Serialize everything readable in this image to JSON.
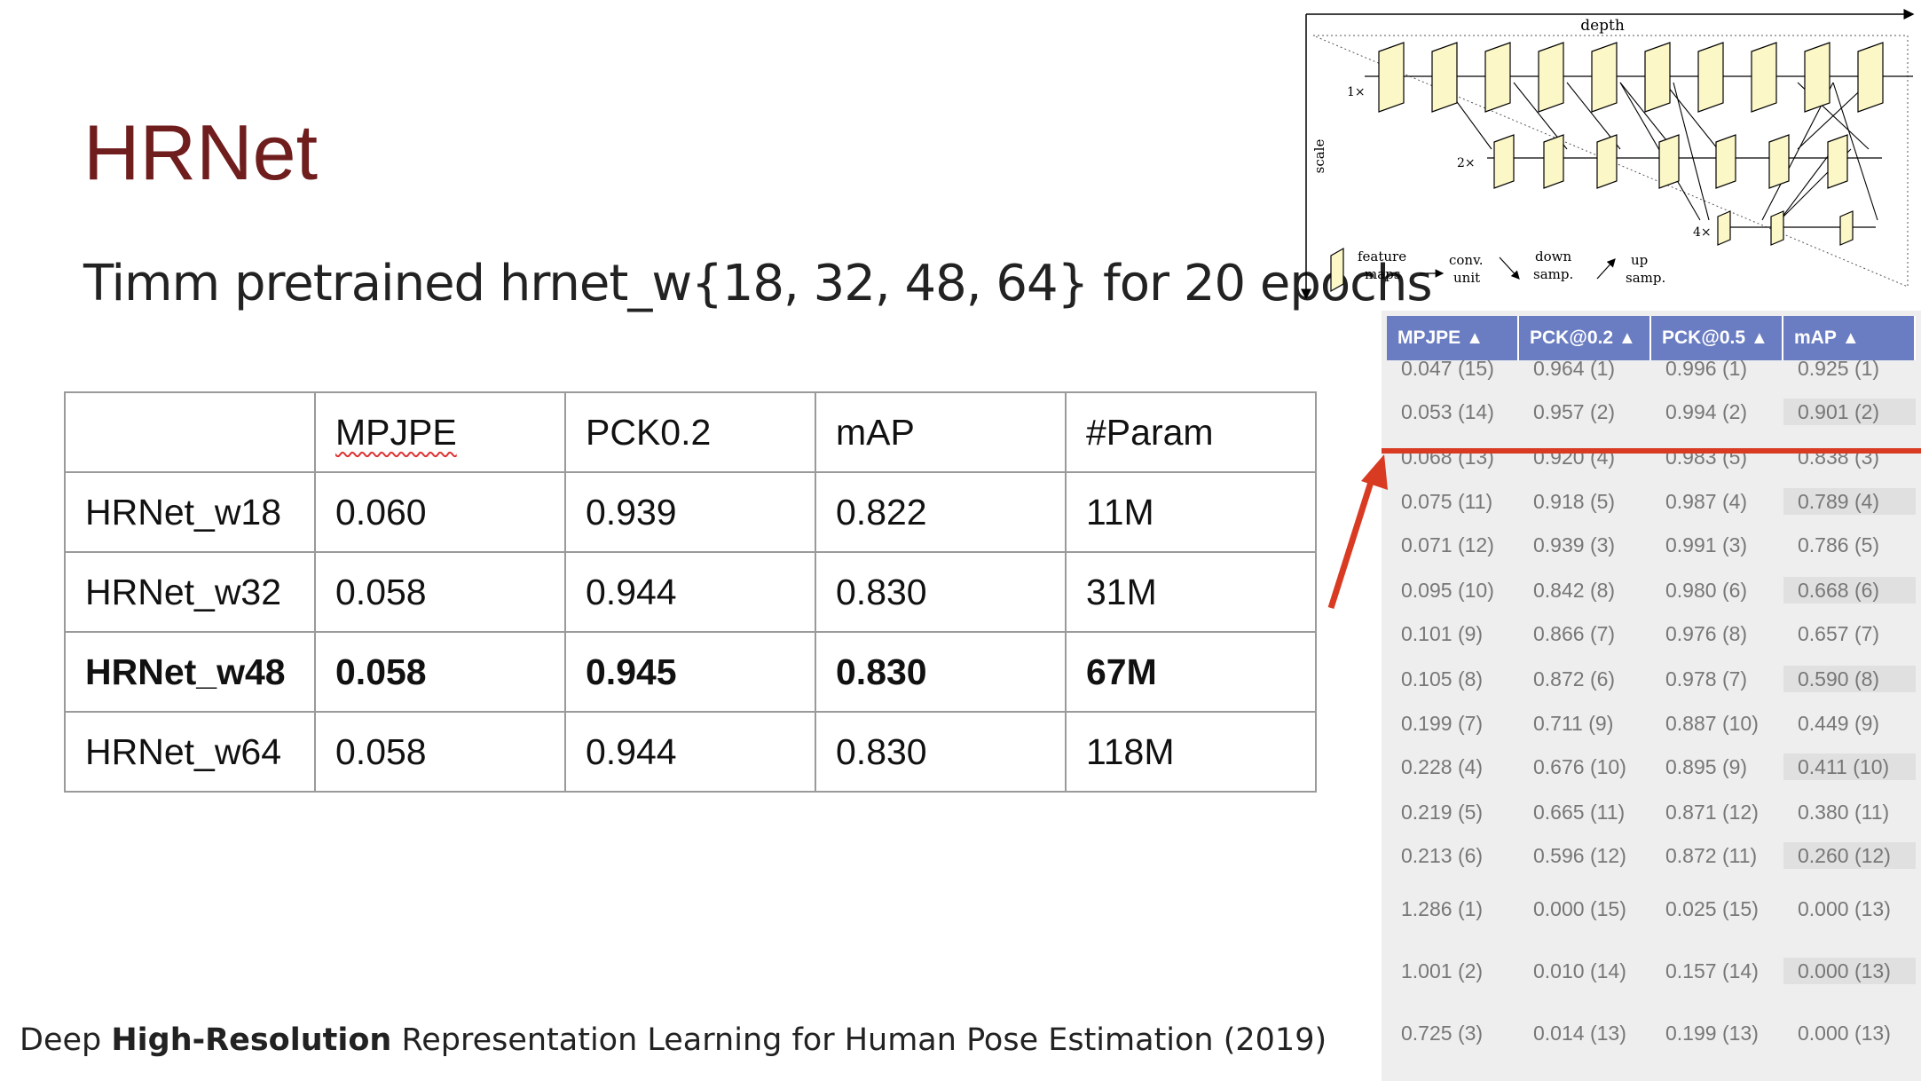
{
  "slide": {
    "title": "HRNet",
    "subtitle": "Timm pretrained hrnet_w{18, 32, 48, 64} for 20 epochs",
    "footer": {
      "pre": "Deep ",
      "bold": "High-Resolution",
      "post": " Representation Learning for Human Pose Estimation (2019)"
    }
  },
  "table": {
    "headers": [
      "",
      "MPJPE",
      "PCK0.2",
      "mAP",
      "#Param"
    ],
    "rows": [
      {
        "model": "HRNet_w18",
        "mpjpe": "0.060",
        "pck": "0.939",
        "map": "0.822",
        "param": "11M",
        "bold": false
      },
      {
        "model": "HRNet_w32",
        "mpjpe": "0.058",
        "pck": "0.944",
        "map": "0.830",
        "param": "31M",
        "bold": false
      },
      {
        "model": "HRNet_w48",
        "mpjpe": "0.058",
        "pck": "0.945",
        "map": "0.830",
        "param": "67M",
        "bold": true
      },
      {
        "model": "HRNet_w64",
        "mpjpe": "0.058",
        "pck": "0.944",
        "map": "0.830",
        "param": "118M",
        "bold": false
      }
    ]
  },
  "diagram": {
    "depth_label": "depth",
    "scale_label": "scale",
    "levels": [
      "1×",
      "2×",
      "4×"
    ],
    "legend": {
      "feature": [
        "feature",
        "maps"
      ],
      "conv": [
        "conv.",
        "unit"
      ],
      "down": [
        "down",
        "samp."
      ],
      "up": [
        "up",
        "samp."
      ]
    }
  },
  "leaderboard": {
    "headers": [
      "MPJPE",
      "PCK@0.2",
      "PCK@0.5",
      "mAP"
    ],
    "sort_arrow": "▲",
    "colors": {
      "header_bg": "#6b7dc2",
      "highlight": "#d93a22"
    },
    "rows": [
      [
        "0.047 (15)",
        "0.964 (1)",
        "0.996 (1)",
        "0.925 (1)"
      ],
      [
        "0.053 (14)",
        "0.957 (2)",
        "0.994 (2)",
        "0.901 (2)"
      ],
      [
        "0.068 (13)",
        "0.920 (4)",
        "0.983 (5)",
        "0.838 (3)"
      ],
      [
        "0.075 (11)",
        "0.918 (5)",
        "0.987 (4)",
        "0.789 (4)"
      ],
      [
        "0.071 (12)",
        "0.939 (3)",
        "0.991 (3)",
        "0.786 (5)"
      ],
      [
        "0.095 (10)",
        "0.842 (8)",
        "0.980 (6)",
        "0.668 (6)"
      ],
      [
        "0.101 (9)",
        "0.866 (7)",
        "0.976 (8)",
        "0.657 (7)"
      ],
      [
        "0.105 (8)",
        "0.872 (6)",
        "0.978 (7)",
        "0.590 (8)"
      ],
      [
        "0.199 (7)",
        "0.711 (9)",
        "0.887 (10)",
        "0.449 (9)"
      ],
      [
        "0.228 (4)",
        "0.676 (10)",
        "0.895 (9)",
        "0.411 (10)"
      ],
      [
        "0.219 (5)",
        "0.665 (11)",
        "0.871 (12)",
        "0.380 (11)"
      ],
      [
        "0.213 (6)",
        "0.596 (12)",
        "0.872 (11)",
        "0.260 (12)"
      ],
      [
        "1.286 (1)",
        "0.000 (15)",
        "0.025 (15)",
        "0.000 (13)"
      ],
      [
        "1.001 (2)",
        "0.010 (14)",
        "0.157 (14)",
        "0.000 (13)"
      ],
      [
        "0.725 (3)",
        "0.014 (13)",
        "0.199 (13)",
        "0.000 (13)"
      ]
    ]
  }
}
